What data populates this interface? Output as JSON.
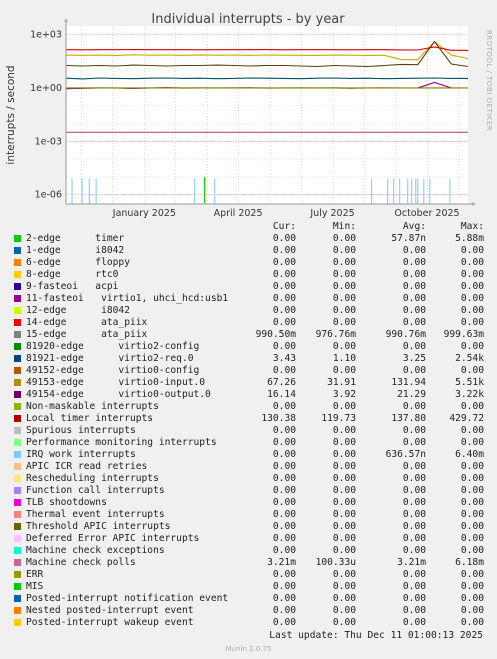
{
  "title": "Individual interrupts - by year",
  "side_text": "RRDTOOL / TOBI OETIKER",
  "chart_data": {
    "type": "line",
    "title": "Individual interrupts - by year",
    "ylabel": "interrupts / second",
    "xlabel": "",
    "yscale": "log",
    "ylim": [
      3e-07,
      3000.0
    ],
    "yticks": [
      {
        "v": 1000,
        "label": "1e+03"
      },
      {
        "v": 1,
        "label": "1e+00"
      },
      {
        "v": 0.001,
        "label": "1e-03"
      },
      {
        "v": 1e-06,
        "label": "1e-06"
      }
    ],
    "xticks": [
      {
        "frac": 0.195,
        "label": "January 2025"
      },
      {
        "frac": 0.428,
        "label": "April 2025"
      },
      {
        "frac": 0.663,
        "label": "July 2025"
      },
      {
        "frac": 0.898,
        "label": "October 2025"
      }
    ],
    "grid": true,
    "series": [
      {
        "name": "11-fasteoi virtio1, uhci_hcd:usb1",
        "color": "#8f008f",
        "values": [
          0.9,
          0.95,
          1.0,
          0.98,
          0.92,
          0.99,
          1.02,
          0.97,
          1.0,
          0.98,
          1.0,
          1.01,
          0.97,
          0.99,
          1.0,
          0.98,
          1.0,
          0.96,
          0.99,
          1.0,
          0.98,
          1.0,
          2.0,
          1.0,
          0.98
        ]
      },
      {
        "name": "49153-edge virtio0-input.0",
        "color": "#ccaa00",
        "values": [
          70,
          68,
          70,
          67,
          72,
          69,
          70,
          68,
          71,
          69,
          70,
          68,
          70,
          69,
          68,
          67,
          70,
          69,
          66,
          68,
          40,
          38,
          400,
          70,
          45
        ]
      },
      {
        "name": "49154-edge virtio0-output.0",
        "color": "#5f3f0f",
        "values": [
          18,
          17,
          18,
          17,
          19,
          18,
          17,
          18,
          18,
          19,
          18,
          17,
          18,
          18,
          17,
          16,
          18,
          17,
          16,
          18,
          21,
          20,
          400,
          22,
          16
        ]
      },
      {
        "name": "Local timer interrupts",
        "color": "#cc0000",
        "values": [
          140,
          138,
          140,
          139,
          141,
          140,
          139,
          140,
          138,
          140,
          139,
          140,
          141,
          138,
          140,
          139,
          140,
          138,
          139,
          140,
          137,
          135,
          200,
          130,
          130
        ]
      },
      {
        "name": "81921-edge virtio2-req.0",
        "color": "#004f5f",
        "values": [
          3.5,
          3.2,
          3.6,
          3.4,
          3.3,
          3.5,
          3.6,
          3.4,
          3.5,
          3.3,
          3.4,
          3.6,
          3.5,
          3.4,
          3.3,
          3.5,
          3.6,
          3.4,
          3.5,
          3.3,
          3.4,
          3.5,
          3.6,
          3.4,
          3.43
        ]
      },
      {
        "name": "15-edge ata_piix",
        "color": "#7f7f00",
        "values": [
          1.0,
          1.0,
          1.0,
          1.0,
          1.0,
          1.0,
          1.0,
          1.0,
          1.0,
          1.0,
          1.0,
          1.0,
          1.0,
          1.0,
          1.0,
          1.0,
          1.0,
          1.0,
          1.0,
          1.0,
          1.0,
          1.0,
          1.0,
          1.0,
          1.0
        ]
      },
      {
        "name": "Machine check polls",
        "color": "#b94f8f",
        "values": [
          0.0032,
          0.0032,
          0.0032,
          0.0032,
          0.0032,
          0.0032,
          0.0032,
          0.0032,
          0.0032,
          0.0032,
          0.0032,
          0.0032,
          0.0032,
          0.0032,
          0.0032,
          0.0032,
          0.0032,
          0.0032,
          0.0032,
          0.0032,
          0.0032,
          0.0032,
          0.0032,
          0.0032,
          0.0032
        ]
      }
    ],
    "spikes": [
      {
        "color": "#8fcfff",
        "x": [
          0.015,
          0.04,
          0.058,
          0.075,
          0.32,
          0.37,
          0.76,
          0.8,
          0.815,
          0.83,
          0.85,
          0.86,
          0.87,
          0.875,
          0.89,
          0.905,
          0.955
        ],
        "value": 8e-06
      },
      {
        "color": "#00cc00",
        "x": [
          0.345
        ],
        "value": 1e-05
      }
    ]
  },
  "legend_header": {
    "cur": "Cur:",
    "min": "Min:",
    "avg": "Avg:",
    "max": "Max:"
  },
  "legend": [
    {
      "color": "#00cc00",
      "label": "2-edge      timer",
      "cur": "0.00",
      "min": "0.00",
      "avg": "57.87n",
      "max": "5.88m"
    },
    {
      "color": "#0066b3",
      "label": "1-edge      i8042",
      "cur": "0.00",
      "min": "0.00",
      "avg": "0.00",
      "max": "0.00"
    },
    {
      "color": "#ff8000",
      "label": "6-edge      floppy",
      "cur": "0.00",
      "min": "0.00",
      "avg": "0.00",
      "max": "0.00"
    },
    {
      "color": "#ffcc00",
      "label": "8-edge      rtc0",
      "cur": "0.00",
      "min": "0.00",
      "avg": "0.00",
      "max": "0.00"
    },
    {
      "color": "#330099",
      "label": "9-fasteoi   acpi",
      "cur": "0.00",
      "min": "0.00",
      "avg": "0.00",
      "max": "0.00"
    },
    {
      "color": "#990099",
      "label": "11-fasteoi   virtio1, uhci_hcd:usb1",
      "cur": "0.00",
      "min": "0.00",
      "avg": "0.00",
      "max": "0.00"
    },
    {
      "color": "#ccff00",
      "label": "12-edge      i8042",
      "cur": "0.00",
      "min": "0.00",
      "avg": "0.00",
      "max": "0.00"
    },
    {
      "color": "#ff0000",
      "label": "14-edge      ata_piix",
      "cur": "0.00",
      "min": "0.00",
      "avg": "0.00",
      "max": "0.00"
    },
    {
      "color": "#808080",
      "label": "15-edge      ata_piix",
      "cur": "990.50m",
      "min": "976.76m",
      "avg": "990.76m",
      "max": "999.63m"
    },
    {
      "color": "#008f00",
      "label": "81920-edge      virtio2-config",
      "cur": "0.00",
      "min": "0.00",
      "avg": "0.00",
      "max": "0.00"
    },
    {
      "color": "#00487d",
      "label": "81921-edge      virtio2-req.0",
      "cur": "3.43",
      "min": "1.10",
      "avg": "3.25",
      "max": "2.54k"
    },
    {
      "color": "#b35a00",
      "label": "49152-edge      virtio0-config",
      "cur": "0.00",
      "min": "0.00",
      "avg": "0.00",
      "max": "0.00"
    },
    {
      "color": "#b38f00",
      "label": "49153-edge      virtio0-input.0",
      "cur": "67.26",
      "min": "31.91",
      "avg": "131.94",
      "max": "5.51k"
    },
    {
      "color": "#6b006b",
      "label": "49154-edge      virtio0-output.0",
      "cur": "16.14",
      "min": "3.92",
      "avg": "21.29",
      "max": "3.22k"
    },
    {
      "color": "#8fb300",
      "label": "Non-maskable interrupts",
      "cur": "0.00",
      "min": "0.00",
      "avg": "0.00",
      "max": "0.00"
    },
    {
      "color": "#b30000",
      "label": "Local timer interrupts",
      "cur": "130.38",
      "min": "119.73",
      "avg": "137.80",
      "max": "429.72"
    },
    {
      "color": "#bebebe",
      "label": "Spurious interrupts",
      "cur": "0.00",
      "min": "0.00",
      "avg": "0.00",
      "max": "0.00"
    },
    {
      "color": "#80ff80",
      "label": "Performance monitoring interrupts",
      "cur": "0.00",
      "min": "0.00",
      "avg": "0.00",
      "max": "0.00"
    },
    {
      "color": "#80c9ff",
      "label": "IRQ work interrupts",
      "cur": "0.00",
      "min": "0.00",
      "avg": "636.57n",
      "max": "6.40m"
    },
    {
      "color": "#ffc080",
      "label": "APIC ICR read retries",
      "cur": "0.00",
      "min": "0.00",
      "avg": "0.00",
      "max": "0.00"
    },
    {
      "color": "#ffe680",
      "label": "Rescheduling interrupts",
      "cur": "0.00",
      "min": "0.00",
      "avg": "0.00",
      "max": "0.00"
    },
    {
      "color": "#aa80ff",
      "label": "Function call interrupts",
      "cur": "0.00",
      "min": "0.00",
      "avg": "0.00",
      "max": "0.00"
    },
    {
      "color": "#ee00cc",
      "label": "TLB shootdowns",
      "cur": "0.00",
      "min": "0.00",
      "avg": "0.00",
      "max": "0.00"
    },
    {
      "color": "#ff8080",
      "label": "Thermal event interrupts",
      "cur": "0.00",
      "min": "0.00",
      "avg": "0.00",
      "max": "0.00"
    },
    {
      "color": "#666600",
      "label": "Threshold APIC interrupts",
      "cur": "0.00",
      "min": "0.00",
      "avg": "0.00",
      "max": "0.00"
    },
    {
      "color": "#ffbfff",
      "label": "Deferred Error APIC interrupts",
      "cur": "0.00",
      "min": "0.00",
      "avg": "0.00",
      "max": "0.00"
    },
    {
      "color": "#00ffcc",
      "label": "Machine check exceptions",
      "cur": "0.00",
      "min": "0.00",
      "avg": "0.00",
      "max": "0.00"
    },
    {
      "color": "#cc6699",
      "label": "Machine check polls",
      "cur": "3.21m",
      "min": "100.33u",
      "avg": "3.21m",
      "max": "6.18m"
    },
    {
      "color": "#999900",
      "label": "ERR",
      "cur": "0.00",
      "min": "0.00",
      "avg": "0.00",
      "max": "0.00"
    },
    {
      "color": "#00cc00",
      "label": "MIS",
      "cur": "0.00",
      "min": "0.00",
      "avg": "0.00",
      "max": "0.00"
    },
    {
      "color": "#0066b3",
      "label": "Posted-interrupt notification event",
      "cur": "0.00",
      "min": "0.00",
      "avg": "0.00",
      "max": "0.00"
    },
    {
      "color": "#ff8000",
      "label": "Nested posted-interrupt event",
      "cur": "0.00",
      "min": "0.00",
      "avg": "0.00",
      "max": "0.00"
    },
    {
      "color": "#ffcc00",
      "label": "Posted-interrupt wakeup event",
      "cur": "0.00",
      "min": "0.00",
      "avg": "0.00",
      "max": "0.00"
    }
  ],
  "last_update": "Last update: Thu Dec 11 01:00:13 2025",
  "version": "Munin 2.0.75"
}
